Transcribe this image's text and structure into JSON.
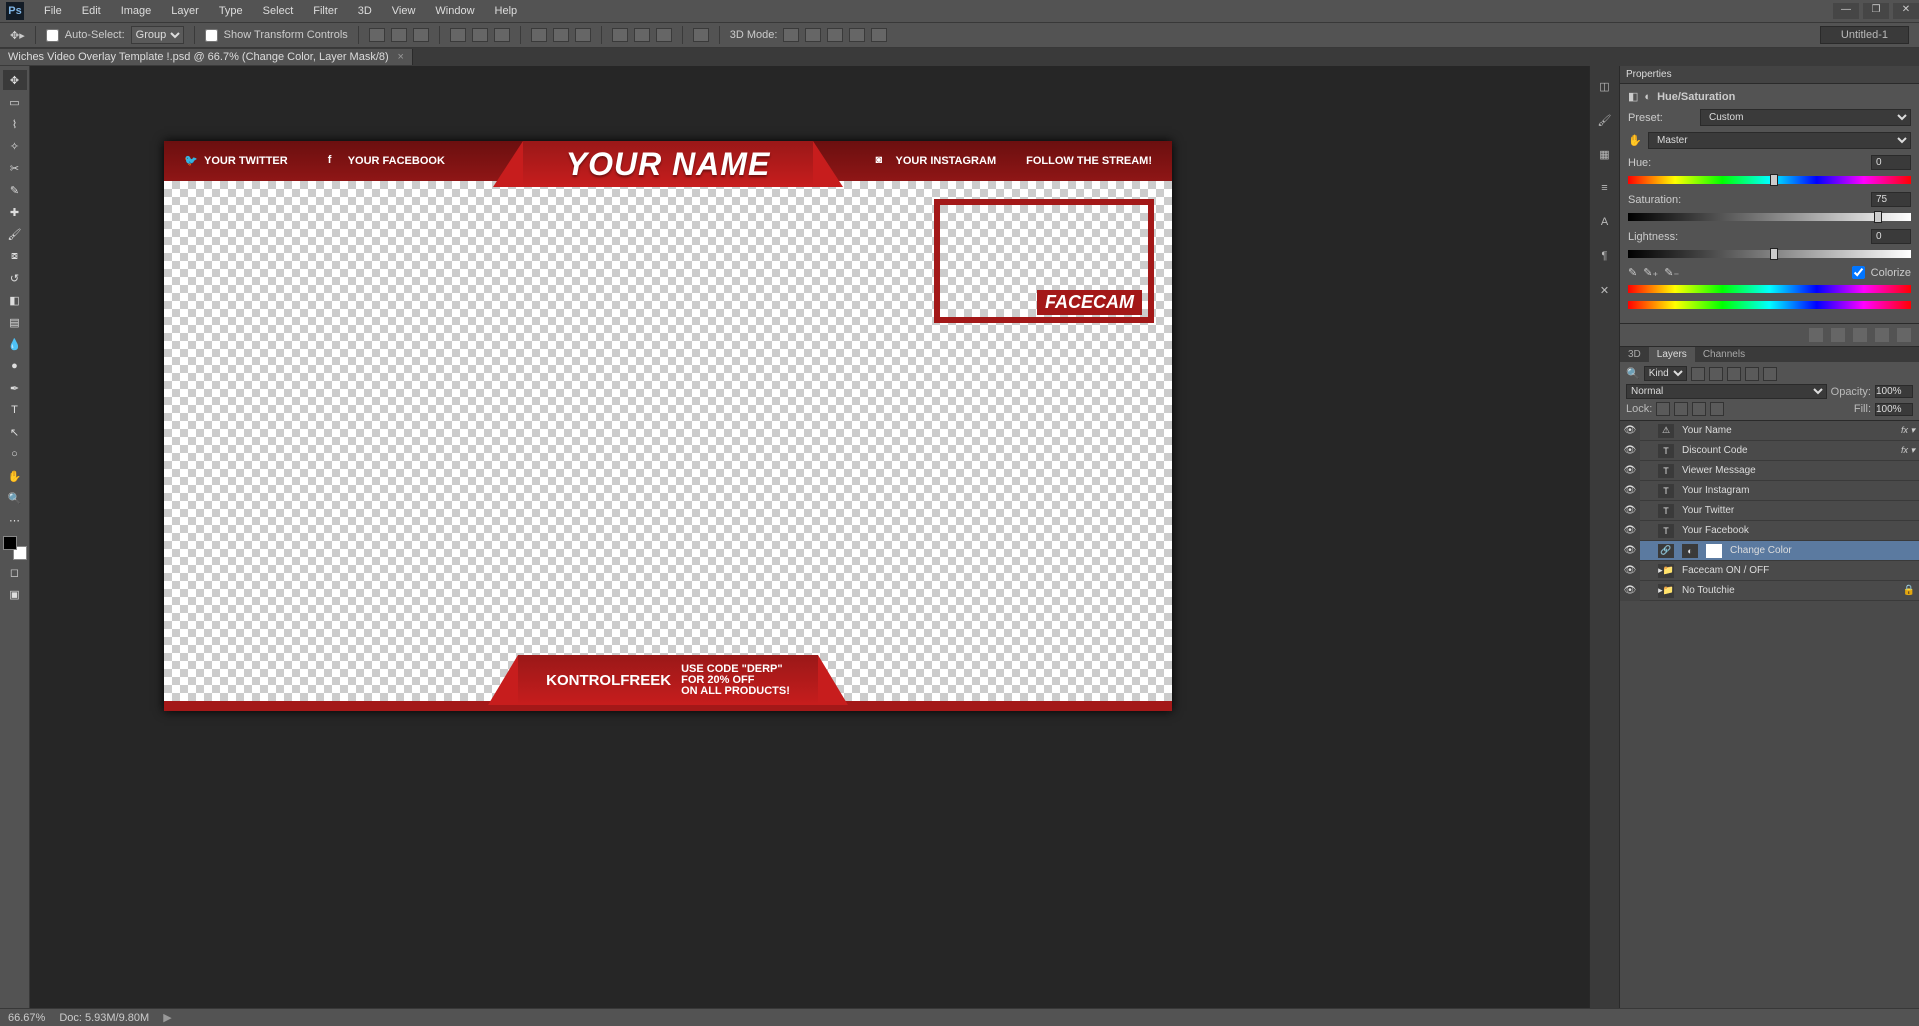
{
  "menubar": {
    "items": [
      "File",
      "Edit",
      "Image",
      "Layer",
      "Type",
      "Select",
      "Filter",
      "3D",
      "View",
      "Window",
      "Help"
    ]
  },
  "optionsbar": {
    "auto_select_label": "Auto-Select:",
    "auto_select_value": "Group",
    "show_transform_label": "Show Transform Controls",
    "mode3d_label": "3D Mode:",
    "untitled_tab": "Untitled-1"
  },
  "doctab": {
    "title": "Wiches Video Overlay Template !.psd @ 66.7% (Change Color, Layer Mask/8)"
  },
  "canvas": {
    "twitter": "YOUR TWITTER",
    "facebook": "YOUR FACEBOOK",
    "name": "YOUR NAME",
    "instagram": "YOUR INSTAGRAM",
    "follow": "FOLLOW THE STREAM!",
    "facecam": "FACECAM",
    "sponsor": "KONTROLFREEK",
    "discount1": "USE CODE \"DERP\"",
    "discount2": "FOR 20% OFF",
    "discount3": "ON ALL PRODUCTS!"
  },
  "properties": {
    "panel_title": "Properties",
    "adj_title": "Hue/Saturation",
    "preset_label": "Preset:",
    "preset_value": "Custom",
    "channel_value": "Master",
    "hue_label": "Hue:",
    "hue_value": "0",
    "sat_label": "Saturation:",
    "sat_value": "75",
    "light_label": "Lightness:",
    "light_value": "0",
    "colorize_label": "Colorize"
  },
  "layers_panel": {
    "tabs": [
      "3D",
      "Layers",
      "Channels"
    ],
    "kind_label": "Kind",
    "blend_mode": "Normal",
    "opacity_label": "Opacity:",
    "opacity_value": "100%",
    "lock_label": "Lock:",
    "fill_label": "Fill:",
    "fill_value": "100%",
    "layers": [
      {
        "name": "Your Name",
        "type": "T",
        "fx": true,
        "warn": true
      },
      {
        "name": "Discount Code",
        "type": "T",
        "fx": true
      },
      {
        "name": "Viewer Message",
        "type": "T"
      },
      {
        "name": "Your Instagram",
        "type": "T"
      },
      {
        "name": "Your Twitter",
        "type": "T"
      },
      {
        "name": "Your Facebook",
        "type": "T"
      },
      {
        "name": "Change Color",
        "type": "adj",
        "sel": true
      },
      {
        "name": "Facecam ON / OFF",
        "type": "group"
      },
      {
        "name": "No Toutchie",
        "type": "group",
        "locked": true
      }
    ]
  },
  "status": {
    "zoom": "66.67%",
    "doc": "Doc: 5.93M/9.80M"
  }
}
